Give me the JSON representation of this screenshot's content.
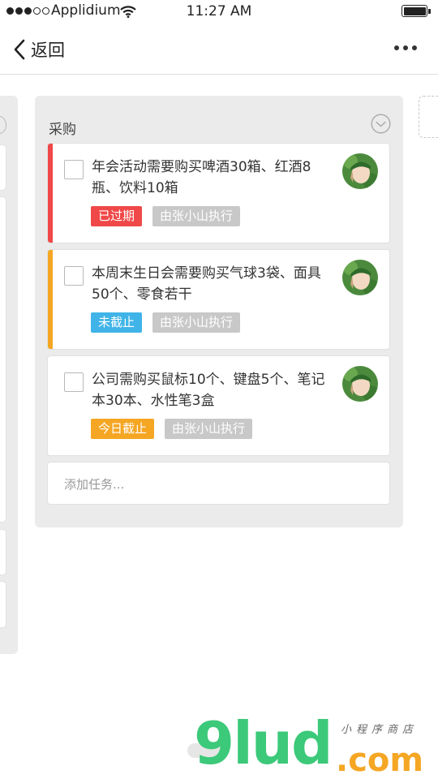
{
  "status_bar": {
    "carrier": "Applidium",
    "time": "11:27 AM",
    "battery_level": 1.0
  },
  "nav": {
    "back_label": "返回",
    "back_icon": "chevron-left-icon",
    "more_icon": "more-horizontal-icon"
  },
  "list": {
    "title": "采购",
    "collapse_icon": "chevron-down-circle-icon",
    "cards": [
      {
        "text": "年会活动需要购买啤酒30箱、红酒8瓶、饮料10箱",
        "stripe_color": "#f04848",
        "checked": false,
        "tags": [
          {
            "label": "已过期",
            "color": "#f04848"
          },
          {
            "label": "由张小山执行",
            "color": "#c8c8c8"
          }
        ]
      },
      {
        "text": "本周末生日会需要购买气球3袋、面具50个、零食若干",
        "stripe_color": "#f5a623",
        "checked": false,
        "tags": [
          {
            "label": "未截止",
            "color": "#40b4e8"
          },
          {
            "label": "由张小山执行",
            "color": "#c8c8c8"
          }
        ]
      },
      {
        "text": "公司需购买鼠标10个、键盘5个、笔记本30本、水性笔3盒",
        "stripe_color": "",
        "checked": false,
        "tags": [
          {
            "label": "今日截止",
            "color": "#f5a623"
          },
          {
            "label": "由张小山执行",
            "color": "#c8c8c8"
          }
        ]
      }
    ],
    "add_task_placeholder": "添加任务..."
  },
  "watermark": {
    "main": "9lud",
    "suffix": ".com",
    "tagline": "小程序商店"
  }
}
